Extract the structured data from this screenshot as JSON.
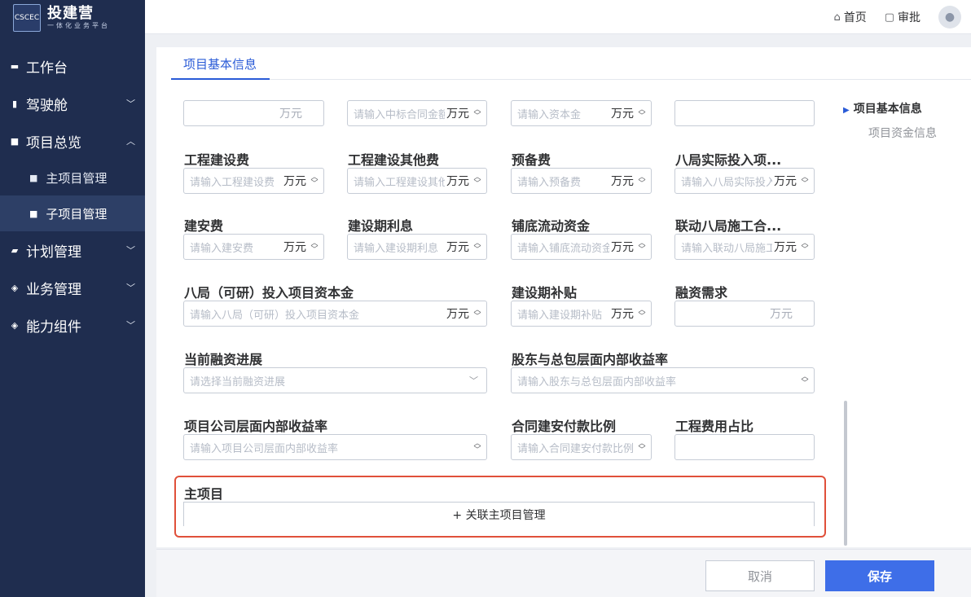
{
  "brand": {
    "name": "投建营",
    "subtitle": "一体化业务平台",
    "logo_text": "CSCEC"
  },
  "topbar": {
    "home": "首页",
    "approve": "审批"
  },
  "sidebar": {
    "items": [
      {
        "label": "工作台"
      },
      {
        "label": "驾驶舱"
      },
      {
        "label": "项目总览"
      },
      {
        "label": "主项目管理"
      },
      {
        "label": "子项目管理"
      },
      {
        "label": "计划管理"
      },
      {
        "label": "业务管理"
      },
      {
        "label": "能力组件"
      }
    ]
  },
  "tab": {
    "label": "项目基本信息"
  },
  "anchors": {
    "basic": "项目基本信息",
    "funding": "项目资金信息"
  },
  "row0": {
    "f1_unit": "万元",
    "f2_placeholder": "请输入中标合同金额",
    "f2_unit": "万元",
    "f3_placeholder": "请输入资本金",
    "f3_unit": "万元"
  },
  "fields": {
    "engineering_cost": {
      "label": "工程建设费",
      "placeholder": "请输入工程建设费",
      "unit": "万元"
    },
    "other_cost": {
      "label": "工程建设其他费",
      "placeholder": "请输入工程建设其他费",
      "unit": "万元"
    },
    "reserve": {
      "label": "预备费",
      "placeholder": "请输入预备费",
      "unit": "万元"
    },
    "bureau_invest": {
      "label": "八局实际投入项...",
      "placeholder": "请输入八局实际投入",
      "unit": "万元"
    },
    "construction_install": {
      "label": "建安费",
      "placeholder": "请输入建安费",
      "unit": "万元"
    },
    "interest": {
      "label": "建设期利息",
      "placeholder": "请输入建设期利息",
      "unit": "万元"
    },
    "working_capital": {
      "label": "铺底流动资金",
      "placeholder": "请输入铺底流动资金",
      "unit": "万元"
    },
    "linked_contract": {
      "label": "联动八局施工合...",
      "placeholder": "请输入联动八局施工合同",
      "unit": "万元"
    },
    "bureau_capital": {
      "label": "八局（可研）投入项目资本金",
      "placeholder": "请输入八局（可研）投入项目资本金",
      "unit": "万元"
    },
    "subsidy": {
      "label": "建设期补贴",
      "placeholder": "请输入建设期补贴",
      "unit": "万元"
    },
    "financing_need": {
      "label": "融资需求",
      "unit": "万元"
    },
    "financing_progress": {
      "label": "当前融资进展",
      "placeholder": "请选择当前融资进展"
    },
    "shareholder_irr": {
      "label": "股东与总包层面内部收益率",
      "placeholder": "请输入股东与总包层面内部收益率"
    },
    "company_irr": {
      "label": "项目公司层面内部收益率",
      "placeholder": "请输入项目公司层面内部收益率"
    },
    "payment_ratio": {
      "label": "合同建安付款比例",
      "placeholder": "请输入合同建安付款比例"
    },
    "cost_ratio": {
      "label": "工程费用占比"
    }
  },
  "main_project": {
    "label": "主项目",
    "link_button": "+ 关联主项目管理"
  },
  "footer": {
    "cancel": "取消",
    "save": "保存"
  }
}
